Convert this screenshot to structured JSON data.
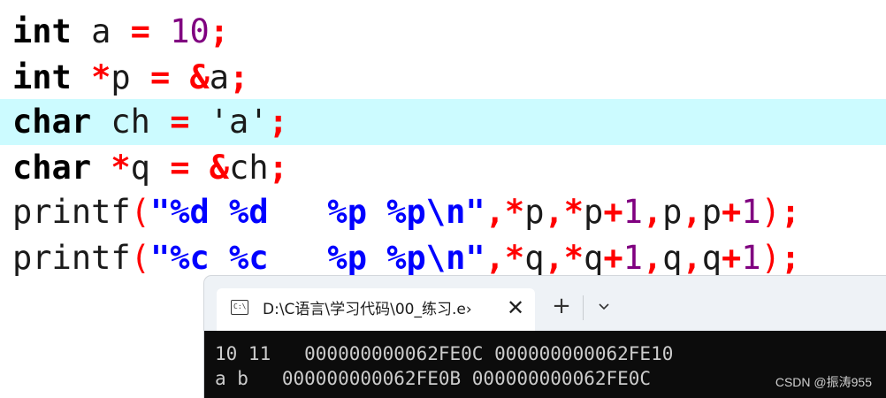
{
  "code": {
    "line1": {
      "kw": "int",
      "mid": " a ",
      "op": "=",
      "sp": " ",
      "num": "10",
      "semi": ";"
    },
    "line2": {
      "kw": "int",
      "sp1": " ",
      "star": "*",
      "mid": "p ",
      "op": "=",
      "sp2": " ",
      "amp": "&",
      "var": "a",
      "semi": ";"
    },
    "line3": {
      "kw": "char",
      "mid": " ch ",
      "op": "=",
      "sp": " ",
      "str": "'a'",
      "semi": ";"
    },
    "line4": {
      "kw": "char",
      "sp1": " ",
      "star": "*",
      "mid": "q ",
      "op": "=",
      "sp2": " ",
      "amp": "&",
      "var": "ch",
      "semi": ";"
    },
    "line5": {
      "fn": "printf",
      "lp": "(",
      "q1": "\"",
      "fmt": "%d %d   %p %p\\n",
      "q2": "\"",
      "c1": ",",
      "s1": "*",
      "a1": "p",
      "c2": ",",
      "s2": "*",
      "a2": "p",
      "plus1": "+",
      "n1": "1",
      "c3": ",",
      "a3": "p",
      "c4": ",",
      "a4": "p",
      "plus2": "+",
      "n2": "1",
      "rp": ")",
      "semi": ";"
    },
    "line6": {
      "fn": "printf",
      "lp": "(",
      "q1": "\"",
      "fmt": "%c %c   %p %p\\n",
      "q2": "\"",
      "c1": ",",
      "s1": "*",
      "a1": "q",
      "c2": ",",
      "s2": "*",
      "a2": "q",
      "plus1": "+",
      "n1": "1",
      "c3": ",",
      "a3": "q",
      "c4": ",",
      "a4": "q",
      "plus2": "+",
      "n2": "1",
      "rp": ")",
      "semi": ";"
    }
  },
  "terminal": {
    "tab_title": "D:\\C语言\\学习代码\\00_练习.e›",
    "tab_icon_text": "C:\\",
    "close_glyph": "✕",
    "new_tab_glyph": "+",
    "output": [
      "10 11   000000000062FE0C 000000000062FE10",
      "a b   000000000062FE0B 000000000062FE0C"
    ]
  },
  "watermark": "CSDN @振涛955",
  "colors": {
    "highlight": "#ccfbff",
    "operator": "#ff0000",
    "number": "#800080",
    "format": "#0000ff",
    "terminal_bg": "#0c0c0c"
  }
}
